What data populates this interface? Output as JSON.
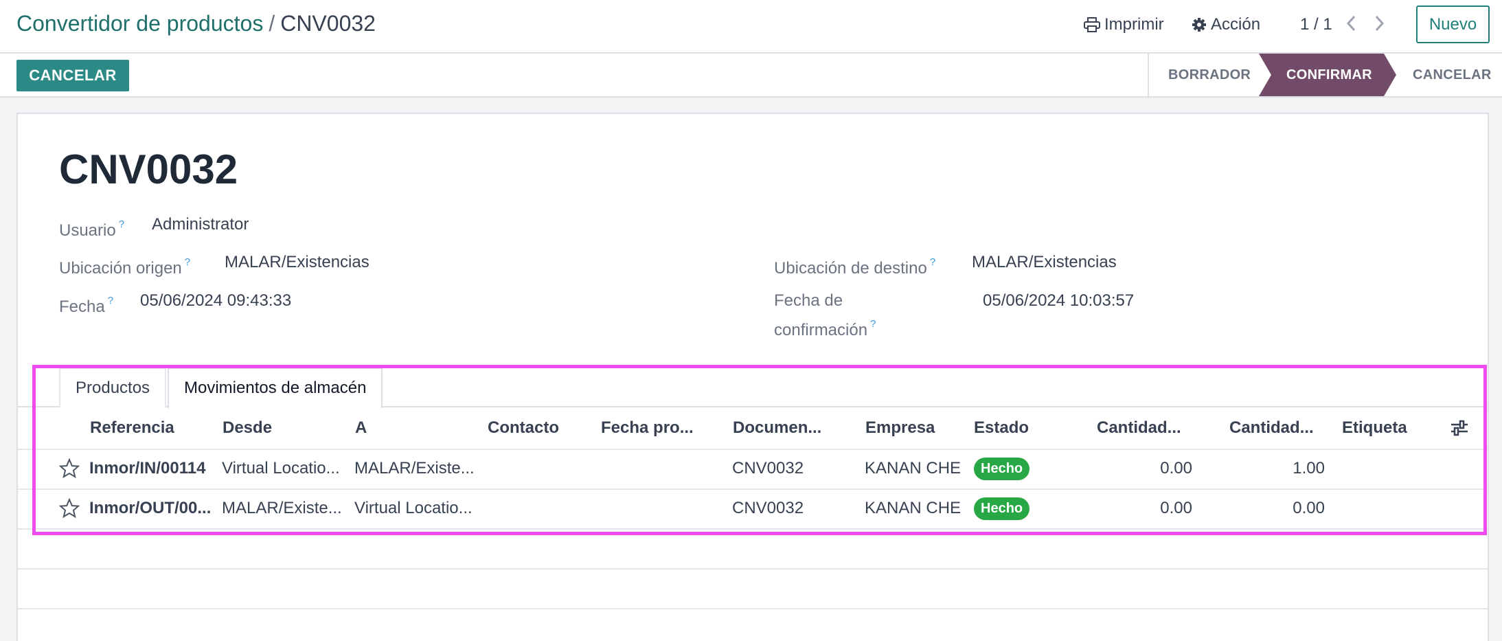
{
  "breadcrumb": {
    "parent": "Convertidor de productos",
    "separator": "/",
    "current": "CNV0032"
  },
  "toolbar": {
    "print_label": "Imprimir",
    "action_label": "Acción",
    "pager": "1 / 1",
    "new_label": "Nuevo"
  },
  "statusbar": {
    "cancel_label": "CANCELAR",
    "stages": [
      {
        "label": "BORRADOR",
        "active": false
      },
      {
        "label": "CONFIRMAR",
        "active": true
      },
      {
        "label": "CANCELAR",
        "active": false
      }
    ],
    "active_color": "#714b67"
  },
  "record": {
    "title": "CNV0032",
    "fields": {
      "usuario": {
        "label": "Usuario",
        "help": "?",
        "value": "Administrator"
      },
      "origen": {
        "label": "Ubicación origen",
        "help": "?",
        "value": "MALAR/Existencias"
      },
      "destino": {
        "label": "Ubicación de destino",
        "help": "?",
        "value": "MALAR/Existencias"
      },
      "fecha": {
        "label": "Fecha",
        "help": "?",
        "value": "05/06/2024 09:43:33"
      },
      "fecha_conf": {
        "label_line1": "Fecha de",
        "label_line2": "confirmación",
        "help": "?",
        "value": "05/06/2024 10:03:57"
      }
    }
  },
  "tabs": [
    {
      "label": "Productos",
      "active": false
    },
    {
      "label": "Movimientos de almacén",
      "active": true
    }
  ],
  "moves_table": {
    "columns": [
      "Referencia",
      "Desde",
      "A",
      "Contacto",
      "Fecha pro...",
      "Documen...",
      "Empresa",
      "Estado",
      "Cantidad...",
      "Cantidad...",
      "Etiqueta"
    ],
    "rows": [
      {
        "referencia": "Inmor/IN/00114",
        "desde": "Virtual Locatio...",
        "a": "MALAR/Existe...",
        "contacto": "",
        "fecha": "",
        "documento": "CNV0032",
        "empresa": "KANAN CHE",
        "estado": "Hecho",
        "cantidad1": "0.00",
        "cantidad2": "1.00",
        "etiqueta": ""
      },
      {
        "referencia": "Inmor/OUT/00...",
        "desde": "MALAR/Existe...",
        "a": "Virtual Locatio...",
        "contacto": "",
        "fecha": "",
        "documento": "CNV0032",
        "empresa": "KANAN CHE",
        "estado": "Hecho",
        "cantidad1": "0.00",
        "cantidad2": "0.00",
        "etiqueta": ""
      }
    ],
    "badge_color": "#28a745"
  },
  "colors": {
    "primary": "#2c8a86",
    "link": "#1f6f6b",
    "highlight": "#ef4bef"
  }
}
